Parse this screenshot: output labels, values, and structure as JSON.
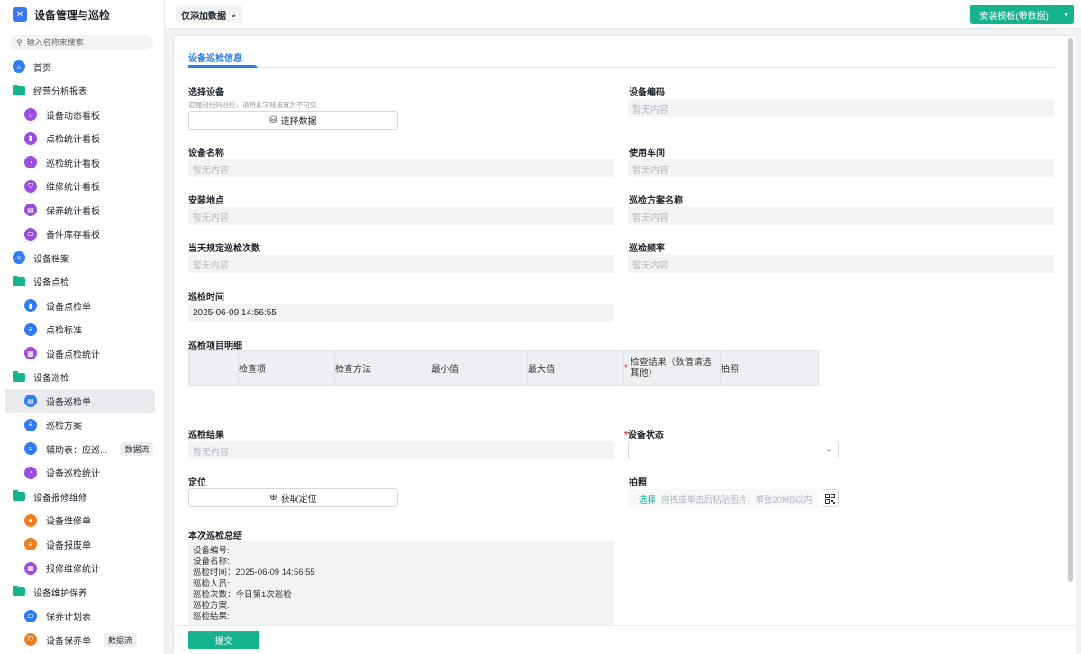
{
  "app": {
    "title": "设备管理与巡检"
  },
  "search": {
    "placeholder": "输入名称来搜索"
  },
  "sidebar": {
    "items": [
      {
        "label": "首页",
        "icon": "home-icon",
        "color": "#2f7cf6"
      },
      {
        "label": "经营分析报表",
        "icon": "folder-icon",
        "color": "#16b38f"
      },
      {
        "label": "设备动态看板",
        "icon": "home-icon",
        "color": "#9b4de0"
      },
      {
        "label": "点检统计看板",
        "icon": "bar-chart-icon",
        "color": "#9b4de0"
      },
      {
        "label": "巡检统计看板",
        "icon": "pie-chart-icon",
        "color": "#9b4de0"
      },
      {
        "label": "维修统计看板",
        "icon": "shield-icon",
        "color": "#9b4de0"
      },
      {
        "label": "保养统计看板",
        "icon": "document-icon",
        "color": "#9b4de0"
      },
      {
        "label": "备件库存看板",
        "icon": "box-icon",
        "color": "#9b4de0"
      },
      {
        "label": "设备档案",
        "icon": "list-icon",
        "color": "#2f7cf6"
      },
      {
        "label": "设备点检",
        "icon": "folder-icon",
        "color": "#16b38f"
      },
      {
        "label": "设备点检单",
        "icon": "bookmark-icon",
        "color": "#2f7cf6"
      },
      {
        "label": "点检标准",
        "icon": "list-icon",
        "color": "#2f7cf6"
      },
      {
        "label": "设备点检统计",
        "icon": "chart-icon",
        "color": "#9b4de0"
      },
      {
        "label": "设备巡检",
        "icon": "folder-icon",
        "color": "#16b38f"
      },
      {
        "label": "设备巡检单",
        "icon": "form-icon",
        "color": "#2f7cf6"
      },
      {
        "label": "巡检方案",
        "icon": "list-icon",
        "color": "#2f7cf6"
      },
      {
        "label": "辅助表：应巡...",
        "icon": "list-icon",
        "color": "#2f7cf6",
        "badge": "数据流"
      },
      {
        "label": "设备巡检统计",
        "icon": "pie-chart-icon",
        "color": "#9b4de0"
      },
      {
        "label": "设备报修维修",
        "icon": "folder-icon",
        "color": "#16b38f"
      },
      {
        "label": "设备维修单",
        "icon": "user-icon",
        "color": "#f07f22"
      },
      {
        "label": "设备报废单",
        "icon": "list-icon",
        "color": "#f07f22"
      },
      {
        "label": "报修维修统计",
        "icon": "chart-icon",
        "color": "#9b4de0"
      },
      {
        "label": "设备维护保养",
        "icon": "folder-icon",
        "color": "#16b38f"
      },
      {
        "label": "保养计划表",
        "icon": "card-icon",
        "color": "#2f7cf6"
      },
      {
        "label": "设备保养单",
        "icon": "shield-icon",
        "color": "#f07f22",
        "badge": "数据流"
      }
    ]
  },
  "topbar": {
    "filter": "仅添加数据",
    "install": "安装模板(带数据)"
  },
  "form": {
    "tab": "设备巡检信息",
    "empty": "暂无内容",
    "select_device": {
      "label": "选择设备",
      "hint": "若强制扫码巡检，请将此字段设置为不可见",
      "button": "选择数据"
    },
    "device_code": {
      "label": "设备编码"
    },
    "device_name": {
      "label": "设备名称"
    },
    "workshop": {
      "label": "使用车间"
    },
    "location": {
      "label": "安装地点"
    },
    "plan_name": {
      "label": "巡检方案名称"
    },
    "daily_count": {
      "label": "当天规定巡检次数"
    },
    "frequency": {
      "label": "巡检频率"
    },
    "time": {
      "label": "巡检时间",
      "value": "2025-06-09 14:56:55"
    },
    "items": {
      "label": "巡检项目明细",
      "columns": [
        "检查项",
        "检查方法",
        "最小值",
        "最大值",
        "检查结果（数值请选其他）",
        "拍照"
      ]
    },
    "result": {
      "label": "巡检结果"
    },
    "status": {
      "label": "设备状态",
      "required": "*"
    },
    "position": {
      "label": "定位",
      "button": "获取定位"
    },
    "photo": {
      "label": "拍照",
      "pick": "选择",
      "tip": "拖拽或单击后粘贴图片，单张20MB以内"
    },
    "summary": {
      "label": "本次巡检总结",
      "lines": [
        "设备编号:",
        "设备名称:",
        "巡检时间：2025-06-09 14:56:55",
        "巡检人员:",
        "巡检次数：今日第1次巡检",
        "巡检方案:",
        "巡检结果:"
      ]
    },
    "submit": "提交"
  }
}
